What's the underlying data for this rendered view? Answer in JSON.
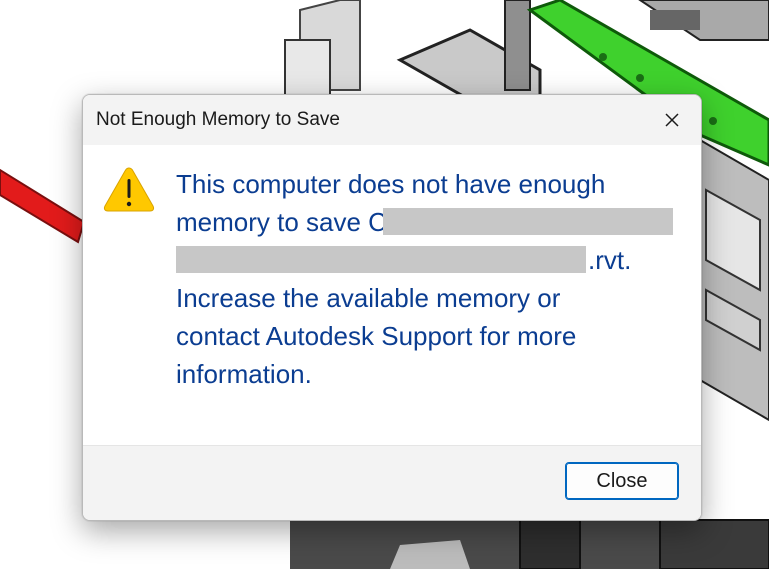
{
  "dialog": {
    "title": "Not Enough Memory to Save",
    "icon": "warning-icon",
    "message_line1": "This computer does not have enough",
    "message_line2_start": "memory to save C",
    "message_line3_end": ".rvt.",
    "message_rest_1": "Increase the available memory or",
    "message_rest_2": "contact Autodesk Support for more",
    "message_rest_3": "information.",
    "close_button_label": "Close"
  },
  "colors": {
    "message_text": "#0b3d91",
    "button_border": "#0067c0",
    "warning_fill": "#ffc800",
    "background_green_beam": "#3fd12d",
    "background_red_beam": "#e21b1b"
  }
}
